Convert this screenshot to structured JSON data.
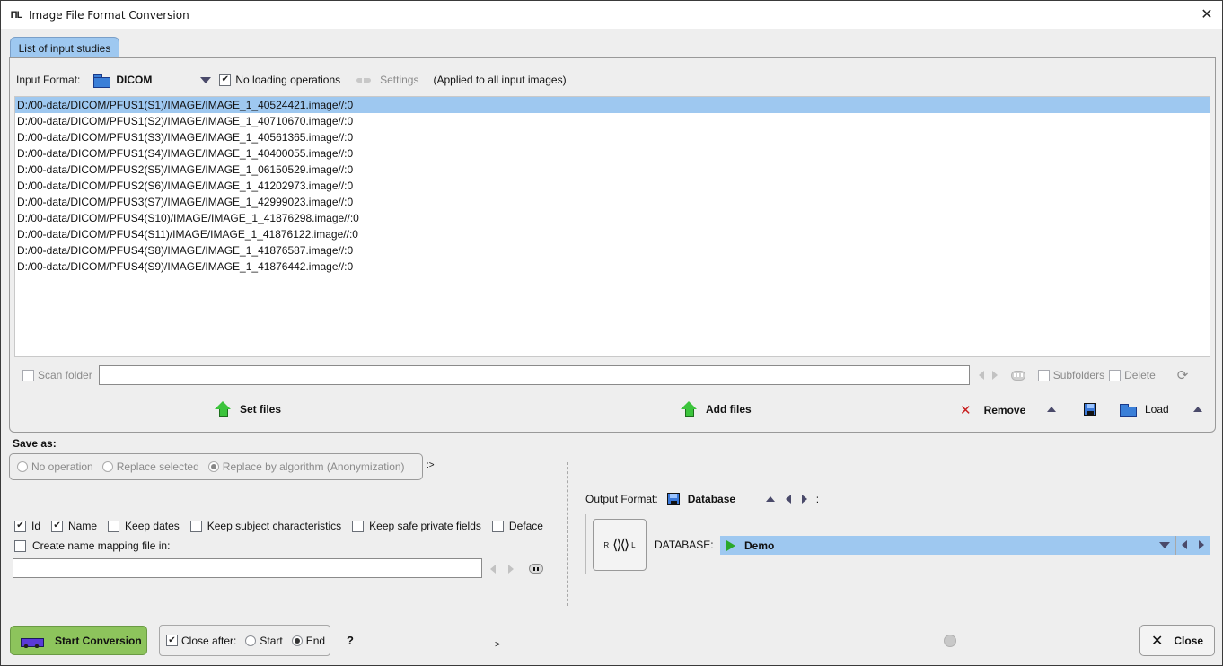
{
  "window": {
    "title": "Image File Format Conversion",
    "app_icon": "pmod-logo-icon",
    "close_glyph": "✕"
  },
  "tabs": [
    {
      "label": "List of input studies",
      "active": true
    }
  ],
  "input": {
    "format_label": "Input Format:",
    "format_value": "DICOM",
    "no_loading_label": "No loading operations",
    "no_loading_checked": true,
    "settings_label": "Settings",
    "applied_note": "(Applied to all input images)"
  },
  "files": [
    "D:/00-data/DICOM/PFUS1(S1)/IMAGE/IMAGE_1_40524421.image//:0",
    "D:/00-data/DICOM/PFUS1(S2)/IMAGE/IMAGE_1_40710670.image//:0",
    "D:/00-data/DICOM/PFUS1(S3)/IMAGE/IMAGE_1_40561365.image//:0",
    "D:/00-data/DICOM/PFUS1(S4)/IMAGE/IMAGE_1_40400055.image//:0",
    "D:/00-data/DICOM/PFUS2(S5)/IMAGE/IMAGE_1_06150529.image//:0",
    "D:/00-data/DICOM/PFUS2(S6)/IMAGE/IMAGE_1_41202973.image//:0",
    "D:/00-data/DICOM/PFUS3(S7)/IMAGE/IMAGE_1_42999023.image//:0",
    "D:/00-data/DICOM/PFUS4(S10)/IMAGE/IMAGE_1_41876298.image//:0",
    "D:/00-data/DICOM/PFUS4(S11)/IMAGE/IMAGE_1_41876122.image//:0",
    "D:/00-data/DICOM/PFUS4(S8)/IMAGE/IMAGE_1_41876587.image//:0",
    "D:/00-data/DICOM/PFUS4(S9)/IMAGE/IMAGE_1_41876442.image//:0"
  ],
  "selected_file_index": 0,
  "scan": {
    "scan_folder_label": "Scan folder",
    "folder_value": "",
    "subfolders_label": "Subfolders",
    "delete_label": "Delete"
  },
  "actions": {
    "set_files": "Set files",
    "add_files": "Add files",
    "remove": "Remove",
    "load": "Load"
  },
  "save_as": {
    "label": "Save as:",
    "options": [
      "No operation",
      "Replace selected",
      "Replace by algorithm (Anonymization)"
    ],
    "selected": 2,
    "suffix": ":>"
  },
  "anonymization": {
    "options": [
      {
        "label": "Id",
        "checked": true
      },
      {
        "label": "Name",
        "checked": true
      },
      {
        "label": "Keep dates",
        "checked": false
      },
      {
        "label": "Keep subject characteristics",
        "checked": false
      },
      {
        "label": "Keep safe private fields",
        "checked": false
      },
      {
        "label": "Deface",
        "checked": false
      }
    ],
    "mapping_label": "Create name mapping file in:",
    "mapping_checked": false,
    "mapping_path": ""
  },
  "output": {
    "format_label": "Output Format:",
    "format_value": "Database",
    "colon": ":",
    "orientation_left": "R",
    "orientation_right": "L",
    "database_label": "DATABASE:",
    "database_value": "Demo"
  },
  "footer": {
    "start_label": "Start Conversion",
    "close_after_label": "Close after:",
    "close_after_checked": true,
    "close_after_options": [
      "Start",
      "End"
    ],
    "close_after_selected": 1,
    "help": "?",
    "prompt": ">",
    "close_label": "Close"
  },
  "colors": {
    "selection": "#9ec8f0",
    "start_button": "#8dc45c",
    "remove_icon": "#c81e1e",
    "play_icon": "#2aa82a"
  }
}
